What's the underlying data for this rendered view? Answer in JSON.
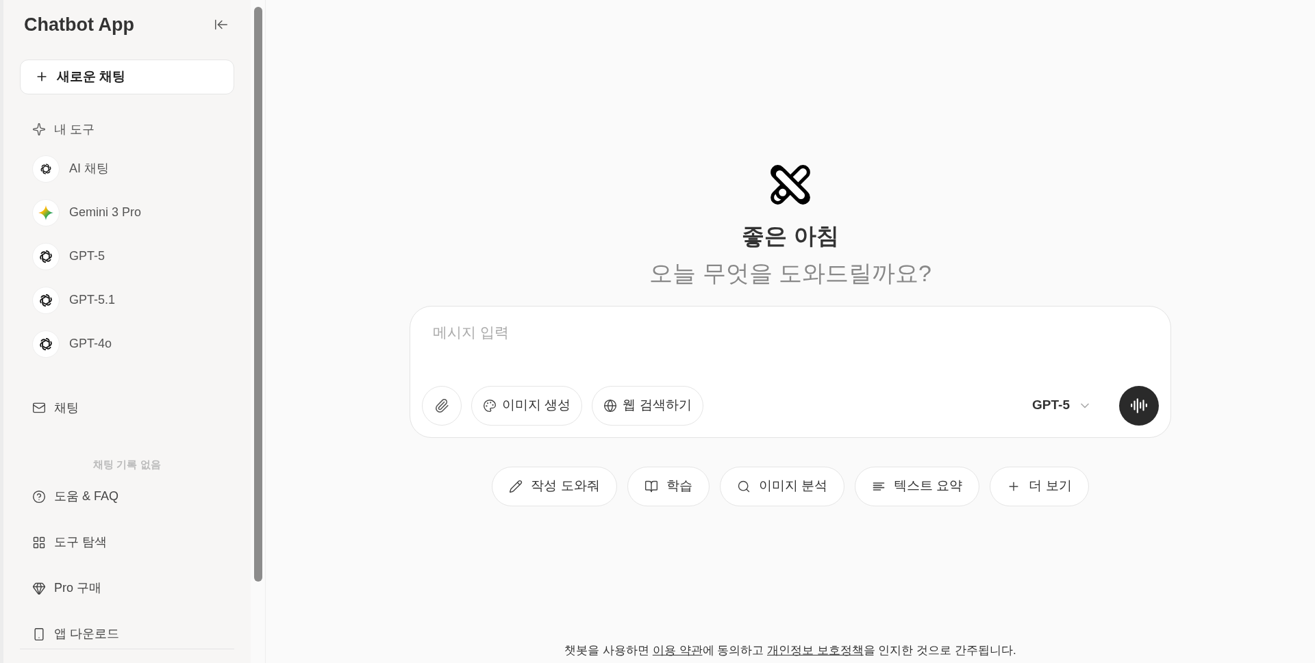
{
  "sidebar": {
    "title": "Chatbot App",
    "new_chat": "새로운 채팅",
    "tools_header": "내 도구",
    "tools": [
      {
        "label": "AI 채팅",
        "kind": "openai-small"
      },
      {
        "label": "Gemini 3 Pro",
        "kind": "gemini"
      },
      {
        "label": "GPT-5",
        "kind": "openai"
      },
      {
        "label": "GPT-5.1",
        "kind": "openai"
      },
      {
        "label": "GPT-4o",
        "kind": "openai"
      }
    ],
    "chat_header": "채팅",
    "empty_history": "채팅 기록 없음",
    "links": [
      {
        "label": "도움 & FAQ",
        "kind": "help"
      },
      {
        "label": "도구 탐색",
        "kind": "grid"
      },
      {
        "label": "Pro 구매",
        "kind": "gem"
      },
      {
        "label": "앱 다운로드",
        "kind": "phone"
      }
    ]
  },
  "main": {
    "greeting": "좋은 아침",
    "subtitle": "오늘 무엇을 도와드릴까요?",
    "composer": {
      "placeholder": "메시지 입력",
      "buttons": [
        {
          "label": "이미지 생성",
          "kind": "palette"
        },
        {
          "label": "웹 검색하기",
          "kind": "globe"
        }
      ],
      "model": "GPT-5"
    },
    "suggestions": [
      {
        "label": "작성 도와줘",
        "kind": "pencil"
      },
      {
        "label": "학습",
        "kind": "book"
      },
      {
        "label": "이미지 분석",
        "kind": "search"
      },
      {
        "label": "텍스트 요약",
        "kind": "lines"
      },
      {
        "label": "더 보기",
        "kind": "plus"
      }
    ],
    "footer": [
      {
        "kind": "text",
        "text": "챗봇을 사용하면 "
      },
      {
        "kind": "link",
        "text": "이용 약관"
      },
      {
        "kind": "text",
        "text": "에 동의하고 "
      },
      {
        "kind": "link",
        "text": "개인정보 보호정책"
      },
      {
        "kind": "text",
        "text": "을 인지한 것으로 간주됩니다."
      }
    ]
  }
}
